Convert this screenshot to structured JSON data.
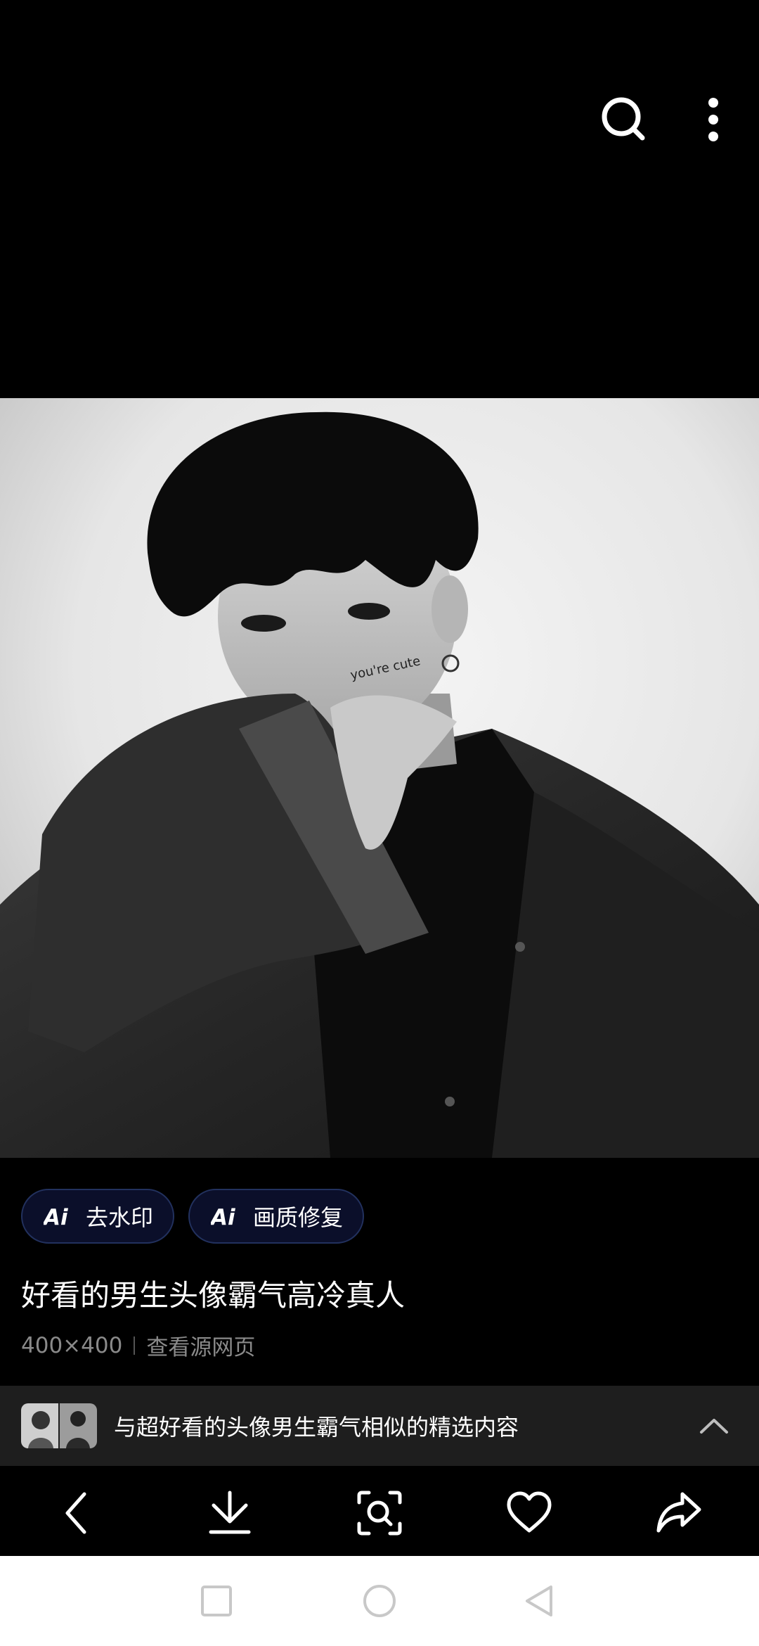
{
  "chips": [
    {
      "ai": "Ai",
      "label": "去水印"
    },
    {
      "ai": "Ai",
      "label": "画质修复"
    }
  ],
  "image": {
    "title": "好看的男生头像霸气高冷真人",
    "size": "400×400",
    "source_link": "查看源网页",
    "face_text": "you're cute"
  },
  "similar": {
    "text": "与超好看的头像男生霸气相似的精选内容"
  },
  "icons": {
    "top": [
      "search-icon",
      "more-vertical-icon"
    ],
    "actions": [
      "back-icon",
      "download-icon",
      "visual-search-icon",
      "heart-icon",
      "share-icon"
    ],
    "system_nav": [
      "recent-apps-icon",
      "home-icon",
      "back-triangle-icon"
    ]
  },
  "colors": {
    "background": "#000000",
    "chip_bg": "#0b0f2a",
    "chip_border": "#22315e",
    "meta_text": "#8a8a8a",
    "similar_bar": "#1e1e1e",
    "system_nav_bg": "#ffffff"
  }
}
